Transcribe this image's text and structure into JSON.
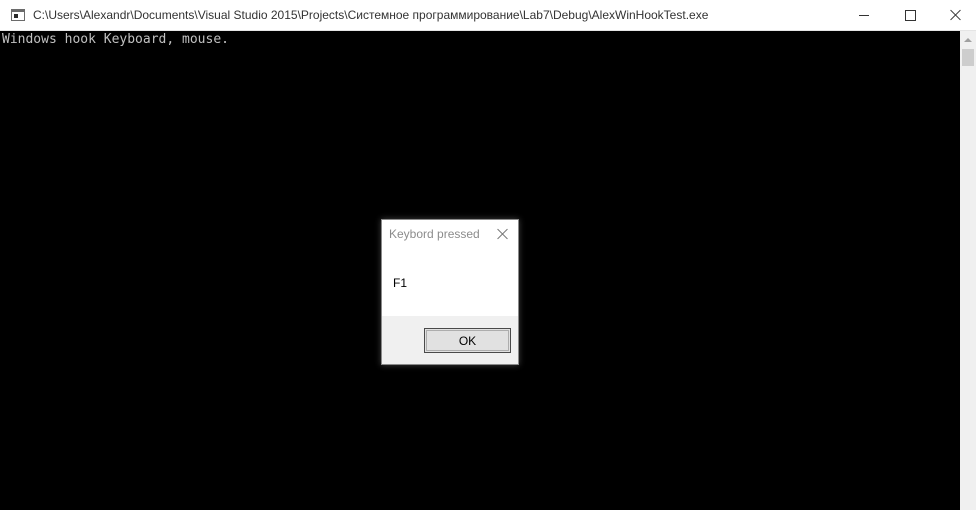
{
  "window": {
    "title": "C:\\Users\\Alexandr\\Documents\\Visual Studio 2015\\Projects\\Системное программирование\\Lab7\\Debug\\AlexWinHookTest.exe",
    "controls": {
      "minimize_icon": "minimize-icon",
      "maximize_icon": "maximize-icon",
      "close_icon": "close-icon"
    }
  },
  "console": {
    "output": "Windows hook Keyboard, mouse.",
    "background_color": "#000000",
    "text_color": "#c0c0c0"
  },
  "dialog": {
    "title": "Keybord pressed",
    "message": "F1",
    "ok_label": "OK"
  }
}
